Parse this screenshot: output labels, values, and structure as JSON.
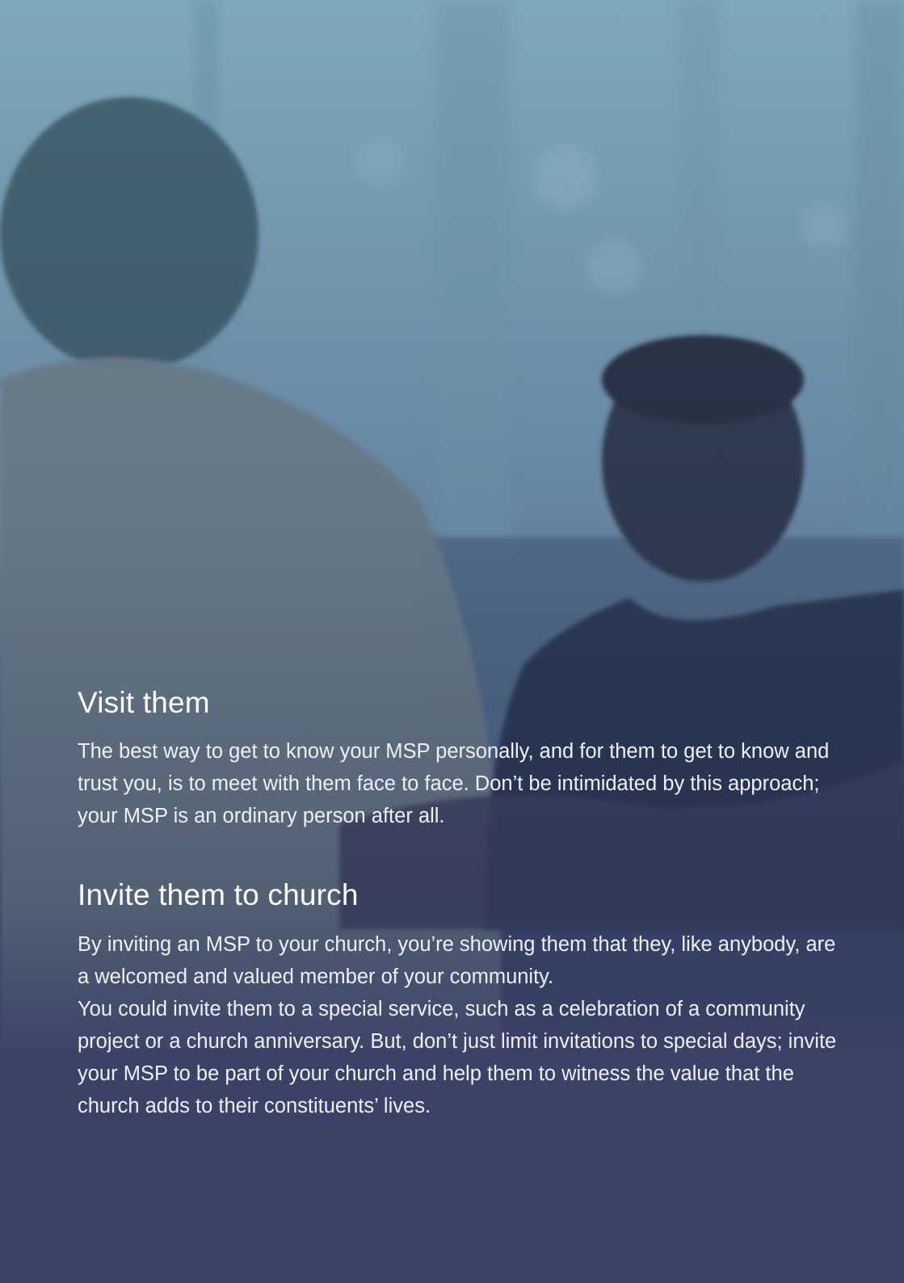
{
  "sections": [
    {
      "title": "Visit them",
      "paragraphs": [
        "The best way to get to know your MSP personally, and for them to get to know and trust you, is to meet with them face to face. Don’t be intimidated by this approach; your MSP is an ordinary person after all."
      ]
    },
    {
      "title": "Invite them to church",
      "paragraphs": [
        "By inviting an MSP to your church, you’re showing them that they, like anybody, are a welcomed and valued member of your community.",
        "You could invite them to a special service, such as a celebration of a community project or a church anniversary. But, don’t just limit invitations to special days; invite your MSP to be part of your church and help them to witness the value that the church adds to their constituents’ lives."
      ]
    }
  ]
}
